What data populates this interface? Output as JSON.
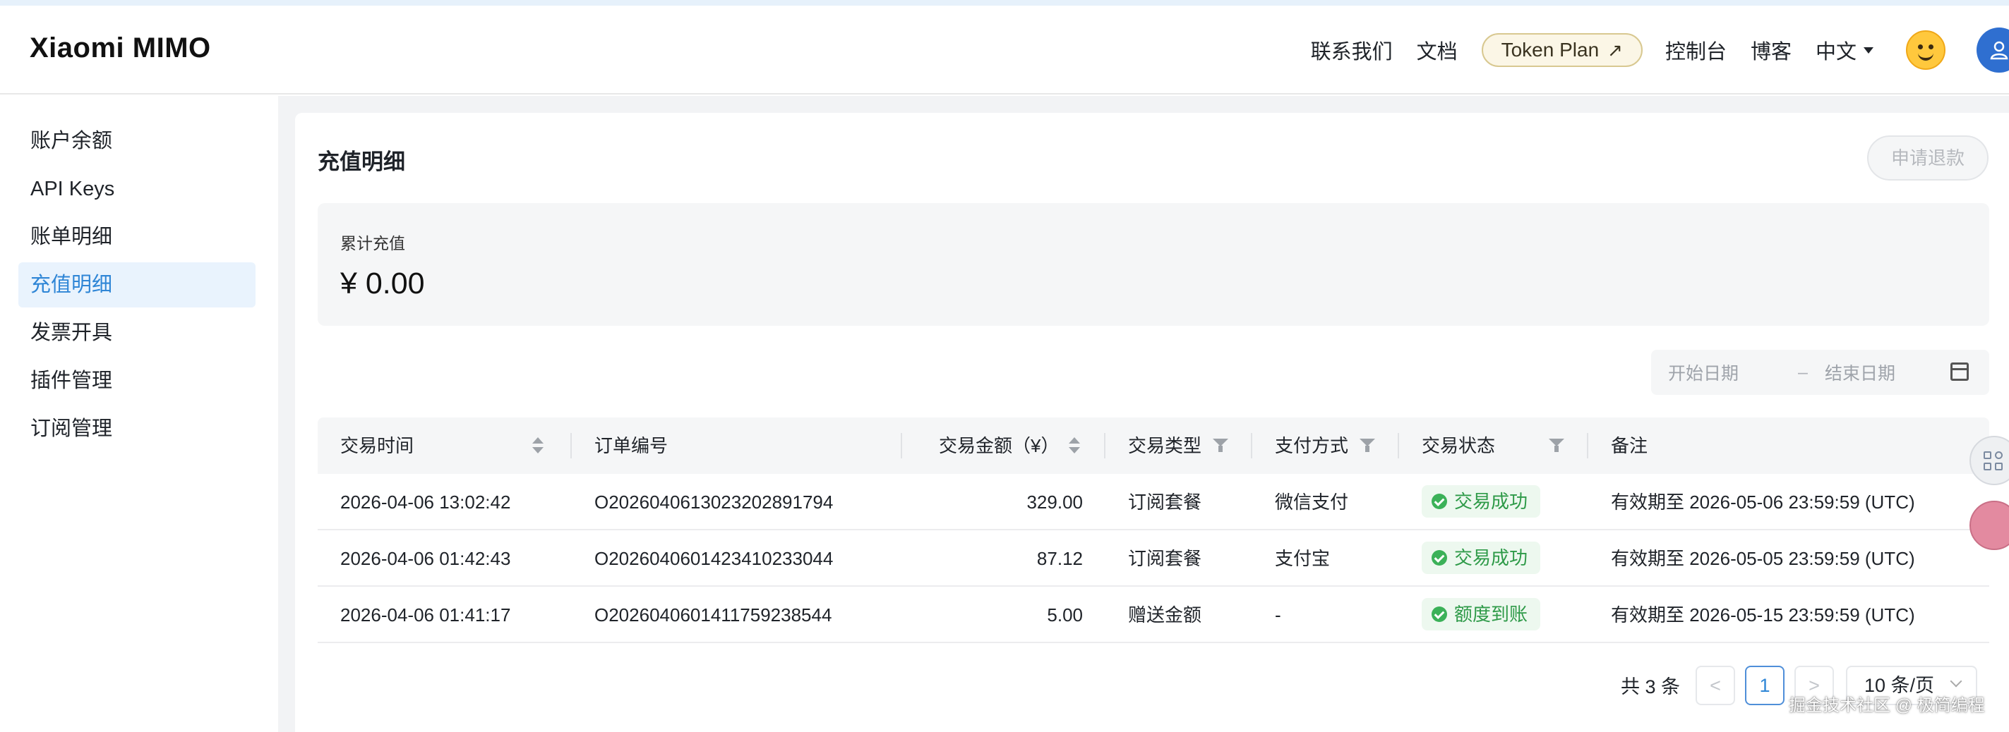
{
  "header": {
    "logo": "Xiaomi MIMO",
    "nav": {
      "contact": "联系我们",
      "docs": "文档",
      "token_plan": "Token Plan",
      "console": "控制台",
      "blog": "博客",
      "language": "中文"
    }
  },
  "sidebar": {
    "items": [
      {
        "label": "账户余额",
        "active": false
      },
      {
        "label": "API Keys",
        "active": false
      },
      {
        "label": "账单明细",
        "active": false
      },
      {
        "label": "充值明细",
        "active": true
      },
      {
        "label": "发票开具",
        "active": false
      },
      {
        "label": "插件管理",
        "active": false
      },
      {
        "label": "订阅管理",
        "active": false
      }
    ]
  },
  "main": {
    "title": "充值明细",
    "refund_button": "申请退款",
    "summary": {
      "label": "累计充值",
      "value": "¥ 0.00"
    },
    "date_range": {
      "start_placeholder": "开始日期",
      "separator": "–",
      "end_placeholder": "结束日期"
    },
    "table": {
      "columns": [
        "交易时间",
        "订单编号",
        "交易金额（¥）",
        "交易类型",
        "支付方式",
        "交易状态",
        "备注"
      ],
      "rows": [
        {
          "time": "2026-04-06 13:02:42",
          "order": "O2026040613023202891794",
          "amount": "329.00",
          "type": "订阅套餐",
          "payment": "微信支付",
          "status": "交易成功",
          "note": "有效期至 2026-05-06 23:59:59 (UTC)"
        },
        {
          "time": "2026-04-06 01:42:43",
          "order": "O2026040601423410233044",
          "amount": "87.12",
          "type": "订阅套餐",
          "payment": "支付宝",
          "status": "交易成功",
          "note": "有效期至 2026-05-05 23:59:59 (UTC)"
        },
        {
          "time": "2026-04-06 01:41:17",
          "order": "O2026040601411759238544",
          "amount": "5.00",
          "type": "赠送金额",
          "payment": "-",
          "status": "额度到账",
          "note": "有效期至 2026-05-15 23:59:59 (UTC)"
        }
      ]
    },
    "pagination": {
      "total": "共 3 条",
      "prev": "<",
      "current": "1",
      "next": ">",
      "page_size": "10 条/页"
    }
  },
  "watermark": "掘金技术社区 @ 极简编程",
  "colors": {
    "accent": "#2f86d6",
    "active_bg": "#e9f3fd",
    "success": "#2e9a48",
    "success_bg": "#edf8ef",
    "panel_bg": "#f5f6f7"
  },
  "icons": [
    "arrow-up-right-icon",
    "caret-down-icon",
    "emoji-avatar-icon",
    "user-icon",
    "calendar-icon",
    "sort-icon",
    "filter-icon",
    "check-circle-icon",
    "chevron-left-icon",
    "chevron-right-icon",
    "chevron-down-icon"
  ]
}
